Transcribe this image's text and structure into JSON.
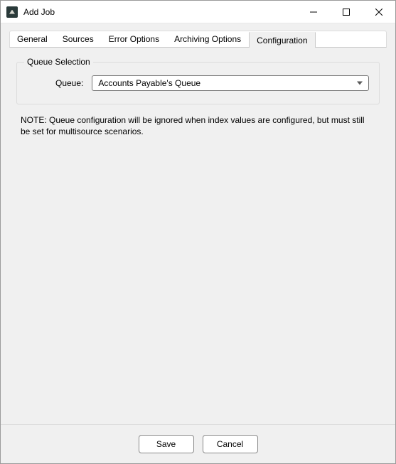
{
  "window": {
    "title": "Add Job"
  },
  "tabs": {
    "general": "General",
    "sources": "Sources",
    "error_options": "Error Options",
    "archiving_options": "Archiving Options",
    "configuration": "Configuration"
  },
  "queue_section": {
    "legend": "Queue Selection",
    "label": "Queue:",
    "selected": "Accounts Payable's Queue"
  },
  "note": "NOTE: Queue configuration will be ignored when index values are configured, but must still be set for multisource scenarios.",
  "buttons": {
    "save": "Save",
    "cancel": "Cancel"
  }
}
